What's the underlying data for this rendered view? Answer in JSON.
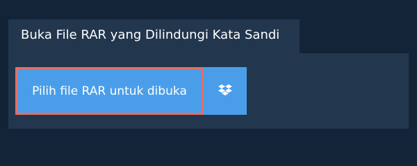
{
  "tab": {
    "title": "Buka File RAR yang Dilindungi Kata Sandi"
  },
  "upload": {
    "pick_label": "Pilih file RAR untuk dibuka",
    "dropbox_icon": "dropbox-icon"
  },
  "colors": {
    "background": "#132338",
    "panel": "#22364d",
    "button": "#4a9ee9",
    "button_outline": "#e76d63",
    "text": "#ffffff"
  }
}
